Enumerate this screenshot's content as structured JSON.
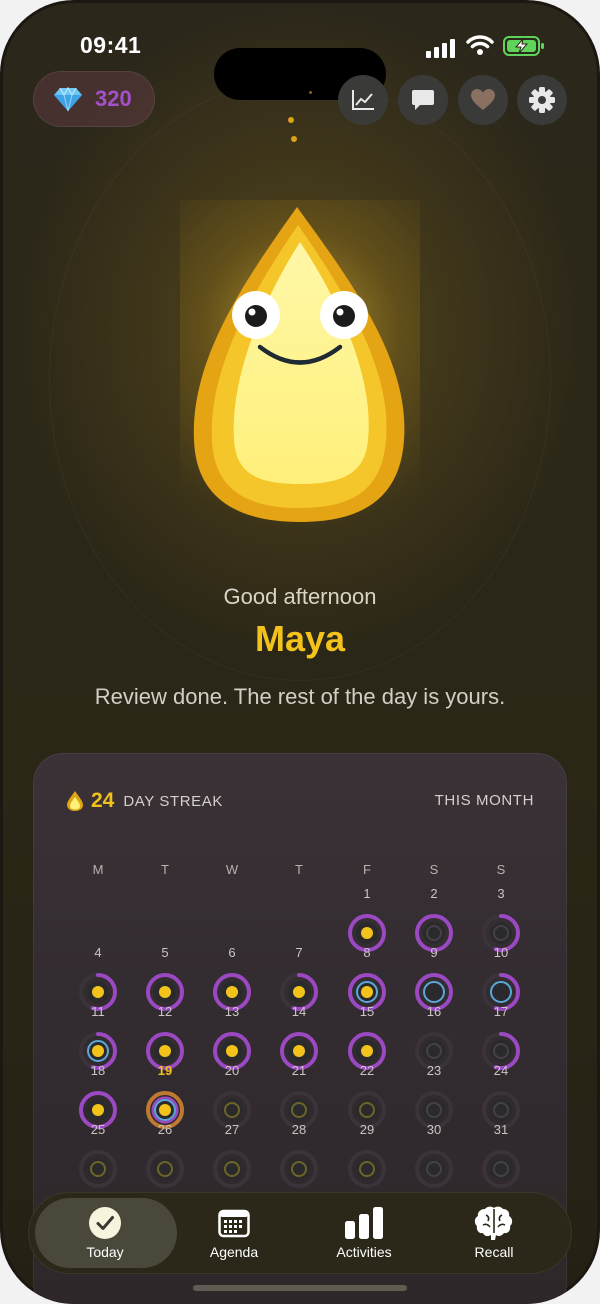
{
  "status_bar": {
    "time": "09:41"
  },
  "header": {
    "gem_count": "320"
  },
  "toolbar": {
    "buttons": [
      {
        "icon": "chart-line-icon"
      },
      {
        "icon": "chat-bubble-icon"
      },
      {
        "icon": "heart-icon"
      },
      {
        "icon": "gear-icon"
      }
    ]
  },
  "greeting": {
    "salutation": "Good afternoon",
    "name": "Maya",
    "message": "Review done. The rest of the day is yours."
  },
  "streak_card": {
    "streak_count": "24",
    "streak_label": "DAY STREAK",
    "period_label": "THIS MONTH",
    "weekdays": [
      "M",
      "T",
      "W",
      "T",
      "F",
      "S",
      "S"
    ],
    "today": 19,
    "days": [
      {
        "day": "1",
        "state": "full"
      },
      {
        "day": "2",
        "state": "full-rest"
      },
      {
        "day": "3",
        "state": "partial-rest"
      },
      {
        "day": "4",
        "state": "partial"
      },
      {
        "day": "5",
        "state": "full"
      },
      {
        "day": "6",
        "state": "full"
      },
      {
        "day": "7",
        "state": "partial"
      },
      {
        "day": "8",
        "state": "full-blue"
      },
      {
        "day": "9",
        "state": "blue"
      },
      {
        "day": "10",
        "state": "partial-blue"
      },
      {
        "day": "11",
        "state": "partial-blue"
      },
      {
        "day": "12",
        "state": "full"
      },
      {
        "day": "13",
        "state": "full"
      },
      {
        "day": "14",
        "state": "full"
      },
      {
        "day": "15",
        "state": "full"
      },
      {
        "day": "16",
        "state": "rest"
      },
      {
        "day": "17",
        "state": "partial-rest"
      },
      {
        "day": "18",
        "state": "full"
      },
      {
        "day": "19",
        "state": "today"
      },
      {
        "day": "20",
        "state": "future"
      },
      {
        "day": "21",
        "state": "future"
      },
      {
        "day": "22",
        "state": "future"
      },
      {
        "day": "23",
        "state": "future-rest"
      },
      {
        "day": "24",
        "state": "future-rest"
      },
      {
        "day": "25",
        "state": "future"
      },
      {
        "day": "26",
        "state": "future"
      },
      {
        "day": "27",
        "state": "future"
      },
      {
        "day": "28",
        "state": "future"
      },
      {
        "day": "29",
        "state": "future"
      },
      {
        "day": "30",
        "state": "future-rest"
      },
      {
        "day": "31",
        "state": "future-rest"
      }
    ]
  },
  "tab_bar": {
    "tabs": [
      {
        "label": "Today",
        "icon": "checkmark-circle-icon",
        "selected": true
      },
      {
        "label": "Agenda",
        "icon": "calendar-icon",
        "selected": false
      },
      {
        "label": "Activities",
        "icon": "bar-chart-icon",
        "selected": false
      },
      {
        "label": "Recall",
        "icon": "brain-icon",
        "selected": false
      }
    ]
  },
  "colors": {
    "accent_gold": "#f3c21b",
    "gem_purple": "#a550c8",
    "ring_purple": "#9b49c2",
    "ring_blue": "#5aa7d8"
  }
}
